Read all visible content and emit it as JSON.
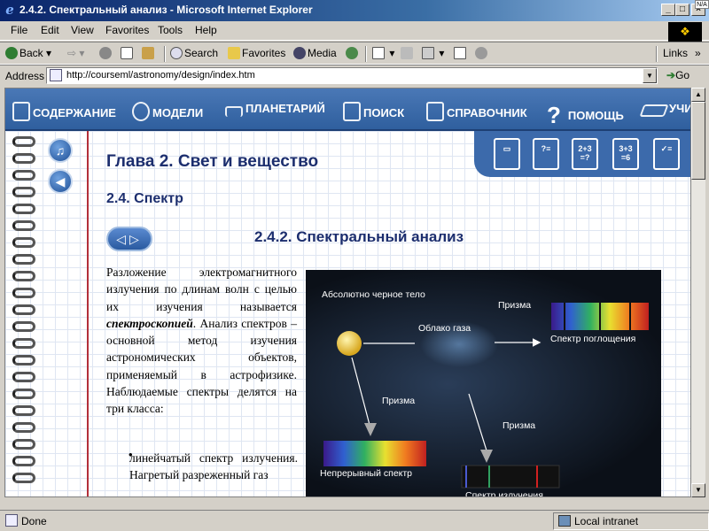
{
  "window": {
    "title": "2.4.2. Спектральный анализ - Microsoft Internet Explorer",
    "corner_badge": "N/A"
  },
  "menu": [
    "File",
    "Edit",
    "View",
    "Favorites",
    "Tools",
    "Help"
  ],
  "toolbar": {
    "back": "Back",
    "forward": "⇨",
    "search": "Search",
    "favorites": "Favorites",
    "media": "Media",
    "links": "Links"
  },
  "address": {
    "label": "Address",
    "url": "http://courseml/astronomy/design/index.htm",
    "go": "Go"
  },
  "nav": [
    {
      "label": "СОДЕРЖАНИЕ",
      "icon": "contents-icon"
    },
    {
      "label": "МОДЕЛИ",
      "icon": "models-gear-icon"
    },
    {
      "label": "ПЛАНЕТАРИЙ",
      "icon": "telescope-icon"
    },
    {
      "label": "ПОИСК",
      "icon": "search-doc-icon"
    },
    {
      "label": "СПРАВОЧНИК",
      "icon": "reference-book-icon"
    },
    {
      "label": "ПОМОЩЬ",
      "icon": "help-question-icon"
    },
    {
      "label": "УЧИ",
      "icon": "graduation-cap-icon"
    }
  ],
  "side_buttons": [
    {
      "icon": "music-note-icon",
      "glyph": "♫"
    },
    {
      "icon": "speaker-icon",
      "glyph": "◀"
    }
  ],
  "tool_panel": [
    {
      "icon": "book-icon",
      "text": "▭"
    },
    {
      "icon": "quiz-icon",
      "text": "?≡"
    },
    {
      "icon": "math-icon-1",
      "text": "2+3 =?"
    },
    {
      "icon": "math-icon-2",
      "text": "3+3 =6"
    },
    {
      "icon": "checklist-icon",
      "text": "✓≡"
    }
  ],
  "page": {
    "chapter": "Глава 2. Свет и вещество",
    "section": "2.4. Спектр",
    "subsection": "2.4.2. Спектральный анализ",
    "nav_arrows": "◁▷",
    "para_before": "Разложение электромагнитного излучения по длинам волн с целью их изучения называется ",
    "para_term": "спектроскопией",
    "para_after": ". Анализ спектров – основной метод изучения астрономических объектов, применяемый в астрофизике. Наблюдаемые спектры делятся на три класса:",
    "bullet": "линейчатый спектр излучения. Нагретый разреженный газ"
  },
  "diagram": {
    "blackbody": "Абсолютно черное тело",
    "gas_cloud": "Облако газа",
    "prism_top": "Призма",
    "absorption": "Спектр поглощения",
    "prism_left": "Призма",
    "prism_right": "Призма",
    "continuous": "Непрерывный спектр",
    "emission": "Спектр излучения"
  },
  "status": {
    "text": "Done",
    "zone": "Local intranet"
  },
  "colors": {
    "nav_blue": "#3c6aab",
    "heading": "#1c2e6e",
    "margin_red": "#b3303a"
  }
}
